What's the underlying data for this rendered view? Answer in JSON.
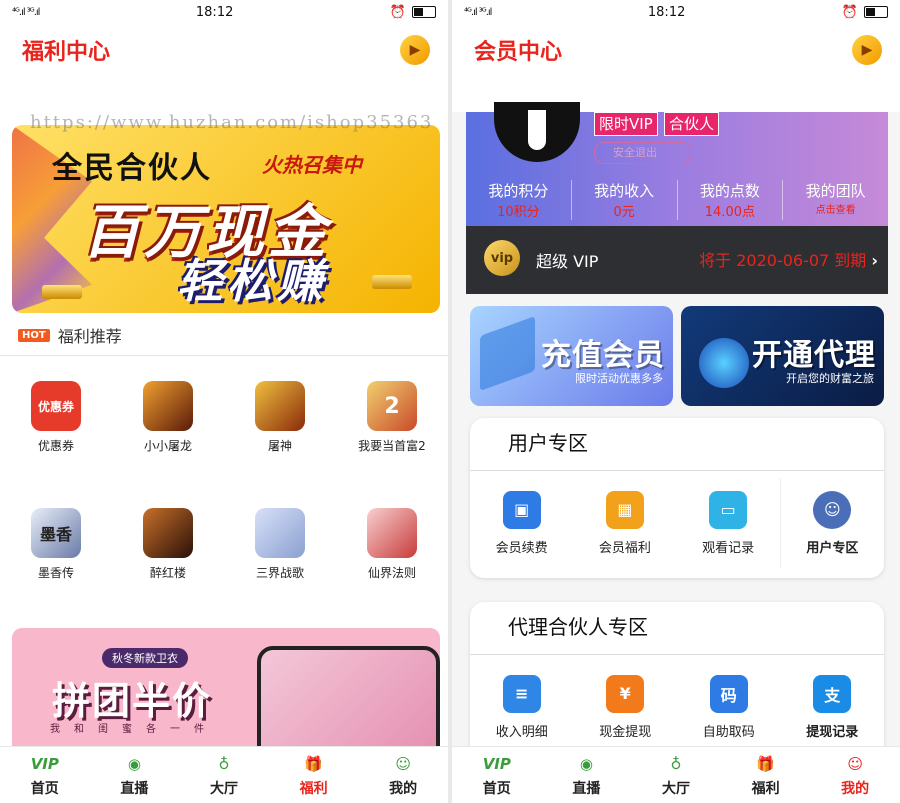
{
  "status": {
    "signal": "⁴ᴳ.ıl ³ᴳ.ıl",
    "time": "18:12"
  },
  "left": {
    "title": "福利中心",
    "banner": {
      "line1": "全民合伙人",
      "line1b": "火热召集中",
      "line2": "百万现金",
      "line3": "轻松赚"
    },
    "watermark": "https://www.huzhan.com/ishop35363",
    "hot_badge": "HOT",
    "section_title": "福利推荐",
    "apps": [
      {
        "label": "优惠券",
        "icon_text": "优惠券",
        "color": "#e63a2b"
      },
      {
        "label": "小小屠龙",
        "icon_text": "",
        "color": "#8a3b1a"
      },
      {
        "label": "屠神",
        "icon_text": "",
        "color": "#a0401a"
      },
      {
        "label": "我要当首富2",
        "icon_text": "2",
        "color": "#c84a2a"
      },
      {
        "label": "墨香传",
        "icon_text": "墨香",
        "color": "#6a7aa8"
      },
      {
        "label": "醉红楼",
        "icon_text": "",
        "color": "#5a3020"
      },
      {
        "label": "三界战歌",
        "icon_text": "",
        "color": "#8aa0d0"
      },
      {
        "label": "仙界法则",
        "icon_text": "",
        "color": "#c83a3a"
      }
    ],
    "banner2": {
      "tag": "秋冬新款卫衣",
      "title": "拼团半价",
      "sub": "我和闺蜜各一件"
    }
  },
  "right": {
    "title": "会员中心",
    "badges": [
      "限时VIP",
      "合伙人"
    ],
    "logout": "安全退出",
    "stats": [
      {
        "label": "我的积分",
        "value": "10积分"
      },
      {
        "label": "我的收入",
        "value": "0元"
      },
      {
        "label": "我的点数",
        "value": "14.00点"
      },
      {
        "label": "我的团队",
        "value": "点击查看"
      }
    ],
    "vip_icon": "vip",
    "vip_label": "超级 VIP",
    "vip_expire": "将于 2020-06-07 到期",
    "promo1": {
      "title": "充值会员",
      "sub": "限时活动优惠多多"
    },
    "promo2": {
      "title": "开通代理",
      "sub": "开启您的财富之旅"
    },
    "user_zone": {
      "title": "用户专区",
      "items": [
        {
          "label": "会员续费",
          "color": "#2f7be6"
        },
        {
          "label": "会员福利",
          "color": "#f2a21a"
        },
        {
          "label": "观看记录",
          "color": "#2fb3e6"
        },
        {
          "label": "用户专区",
          "color": "#4a6fb8"
        }
      ]
    },
    "agent_zone": {
      "title": "代理合伙人专区",
      "items": [
        {
          "label": "收入明细",
          "color": "#2f86e6",
          "icon_text": "≡"
        },
        {
          "label": "现金提现",
          "color": "#f27a1a",
          "icon_text": "¥"
        },
        {
          "label": "自助取码",
          "color": "#2f7be6",
          "icon_text": "码"
        },
        {
          "label": "提现记录",
          "color": "#1a8ce6",
          "icon_text": "支"
        }
      ]
    }
  },
  "tabs_left": [
    {
      "label": "首页",
      "icon": "VIP",
      "active": false
    },
    {
      "label": "直播",
      "icon": "◉",
      "active": false
    },
    {
      "label": "大厅",
      "icon": "♁",
      "active": false
    },
    {
      "label": "福利",
      "icon": "🎁",
      "active": true
    },
    {
      "label": "我的",
      "icon": "☺",
      "active": false
    }
  ],
  "tabs_right": [
    {
      "label": "首页",
      "icon": "VIP",
      "active": false
    },
    {
      "label": "直播",
      "icon": "◉",
      "active": false
    },
    {
      "label": "大厅",
      "icon": "♁",
      "active": false
    },
    {
      "label": "福利",
      "icon": "🎁",
      "active": false
    },
    {
      "label": "我的",
      "icon": "☺",
      "active": true
    }
  ]
}
